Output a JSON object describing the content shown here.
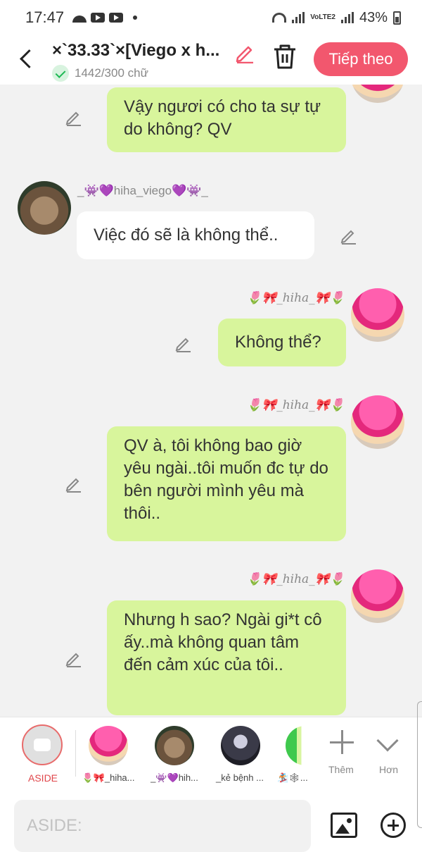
{
  "status_bar": {
    "time": "17:47",
    "network": "VoLTE2",
    "battery": "43%"
  },
  "header": {
    "title": "×`33.33`×[Viego x h...",
    "word_count": "1442/300 chữ",
    "next_button": "Tiếp theo",
    "accent_color": "#f2576e"
  },
  "messages": [
    {
      "side": "right",
      "sender": "",
      "text": "Vậy ngươi có cho ta sự tự do không? QV"
    },
    {
      "side": "left",
      "sender": "_👾💜hiha_viego💜👾_",
      "text": "Việc đó sẽ là không thể.."
    },
    {
      "side": "right",
      "sender": "🌷🎀_hiha_🎀🌷",
      "text": "Không thể?"
    },
    {
      "side": "right",
      "sender": "🌷🎀_hiha_🎀🌷",
      "text": "QV à, tôi không bao giờ yêu ngài..tôi muốn đc tự do bên người mình yêu mà thôi.."
    },
    {
      "side": "right",
      "sender": "🌷🎀_hiha_🎀🌷",
      "text": "Nhưng h sao? Ngài gi*t cô ấy..mà không quan tâm đến cảm xúc của tôi.."
    }
  ],
  "cast": {
    "aside_label": "ASIDE",
    "members": [
      "🌷🎀_hiha...",
      "_👾💜hih...",
      "_kẻ bệnh ...",
      "🏂🕸..."
    ],
    "add_label": "Thêm",
    "more_label": "Hơn"
  },
  "input": {
    "placeholder": "ASIDE:"
  }
}
